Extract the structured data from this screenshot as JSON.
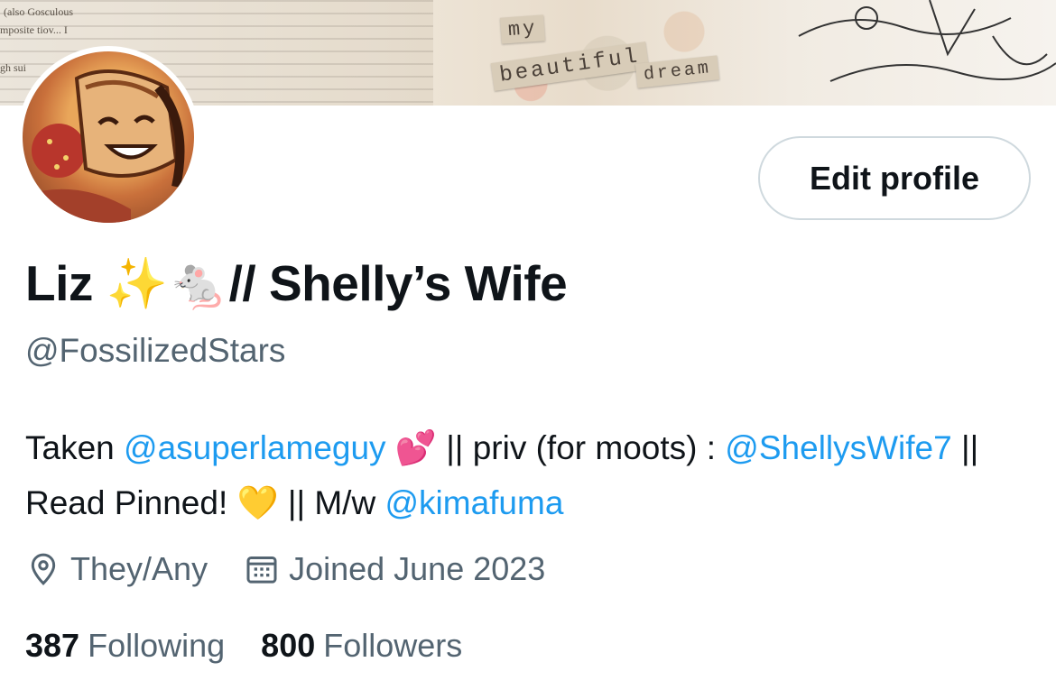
{
  "banner": {
    "tag_words": [
      "my",
      "beautiful",
      "dream"
    ],
    "newsprint_lines": [
      "(also  Gosculous",
      "mposite  tiov...  I",
      "gh sui"
    ]
  },
  "profile": {
    "display_name": "Liz ✨🐁// Shelly’s Wife",
    "handle": "@FossilizedStars",
    "edit_button_label": "Edit profile",
    "bio": {
      "t1": "Taken ",
      "m1": "@asuperlameguy",
      "t2": " 💕 || priv (for moots) : ",
      "m2": "@ShellysWife7",
      "t3": " || Read Pinned! 💛 || M/w ",
      "m3": "@kimafuma"
    },
    "pronouns": "They/Any",
    "joined": "Joined June 2023",
    "following_count": "387",
    "following_label": "Following",
    "followers_count": "800",
    "followers_label": "Followers"
  },
  "icons": {
    "location": "location-pin-icon",
    "calendar": "calendar-icon"
  },
  "colors": {
    "link": "#1d9bf0",
    "secondary_text": "#536471",
    "primary_text": "#0f1419",
    "button_border": "#cfd9de"
  }
}
